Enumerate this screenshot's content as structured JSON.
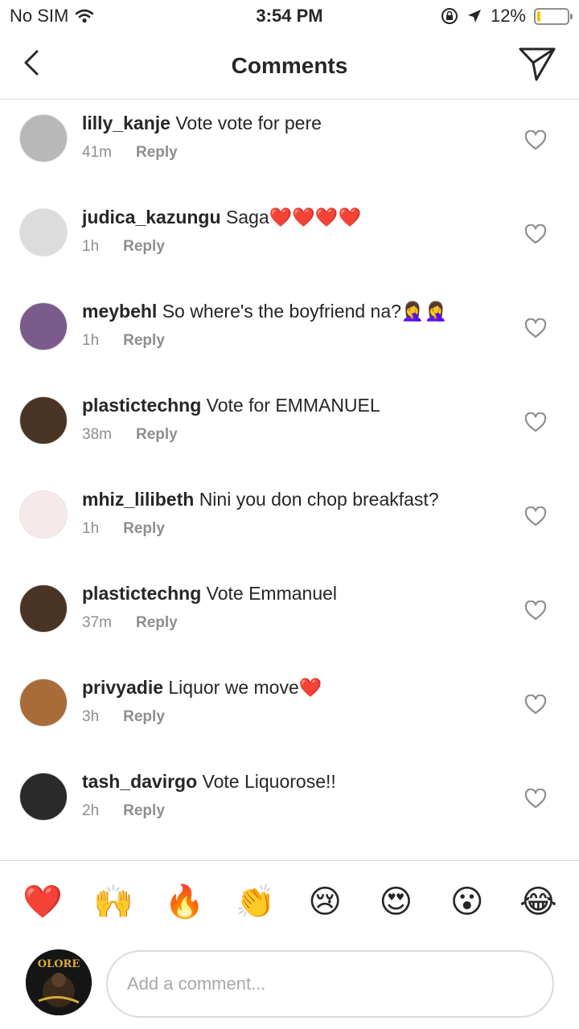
{
  "status_bar": {
    "carrier": "No SIM",
    "time": "3:54 PM",
    "battery": "12%",
    "battery_level": 0.12
  },
  "header": {
    "title": "Comments"
  },
  "comments": [
    {
      "username": "lilly_kanje",
      "text": "Vote vote for pere",
      "time": "41m",
      "reply": "Reply",
      "avatar": "#b8b8b8"
    },
    {
      "username": "judica_kazungu",
      "text": "Saga❤️❤️❤️❤️",
      "time": "1h",
      "reply": "Reply",
      "avatar": "#dcdcdc"
    },
    {
      "username": "meybehl",
      "text": "So where's the boyfriend na?🤦‍♀️🤦‍♀️",
      "time": "1h",
      "reply": "Reply",
      "avatar": "#7a5b8c"
    },
    {
      "username": "plastictechng",
      "text": "Vote for EMMANUEL",
      "time": "38m",
      "reply": "Reply",
      "avatar": "#4a3426"
    },
    {
      "username": "mhiz_lilibeth",
      "text": "Nini you don chop breakfast?",
      "time": "1h",
      "reply": "Reply",
      "avatar": "#f6e9e9"
    },
    {
      "username": "plastictechng",
      "text": "Vote Emmanuel",
      "time": "37m",
      "reply": "Reply",
      "avatar": "#4a3426"
    },
    {
      "username": "privyadie",
      "text": "Liquor  we  move❤️",
      "time": "3h",
      "reply": "Reply",
      "avatar": "#a86b3a"
    },
    {
      "username": "tash_davirgo",
      "text": "Vote Liquorose!!",
      "time": "2h",
      "reply": "Reply",
      "avatar": "#2a2a2a"
    }
  ],
  "reactions": [
    "❤️",
    "🙌",
    "🔥",
    "👏",
    "😢",
    "😍",
    "😮",
    "😂"
  ],
  "composer": {
    "placeholder": "Add a comment...",
    "avatar_text": "OLORE"
  },
  "icons": {
    "back": "chevron-left-icon",
    "send": "paper-plane-icon",
    "like": "heart-outline-icon",
    "wifi": "wifi-icon",
    "location": "location-arrow-icon",
    "lock": "orientation-lock-icon"
  }
}
